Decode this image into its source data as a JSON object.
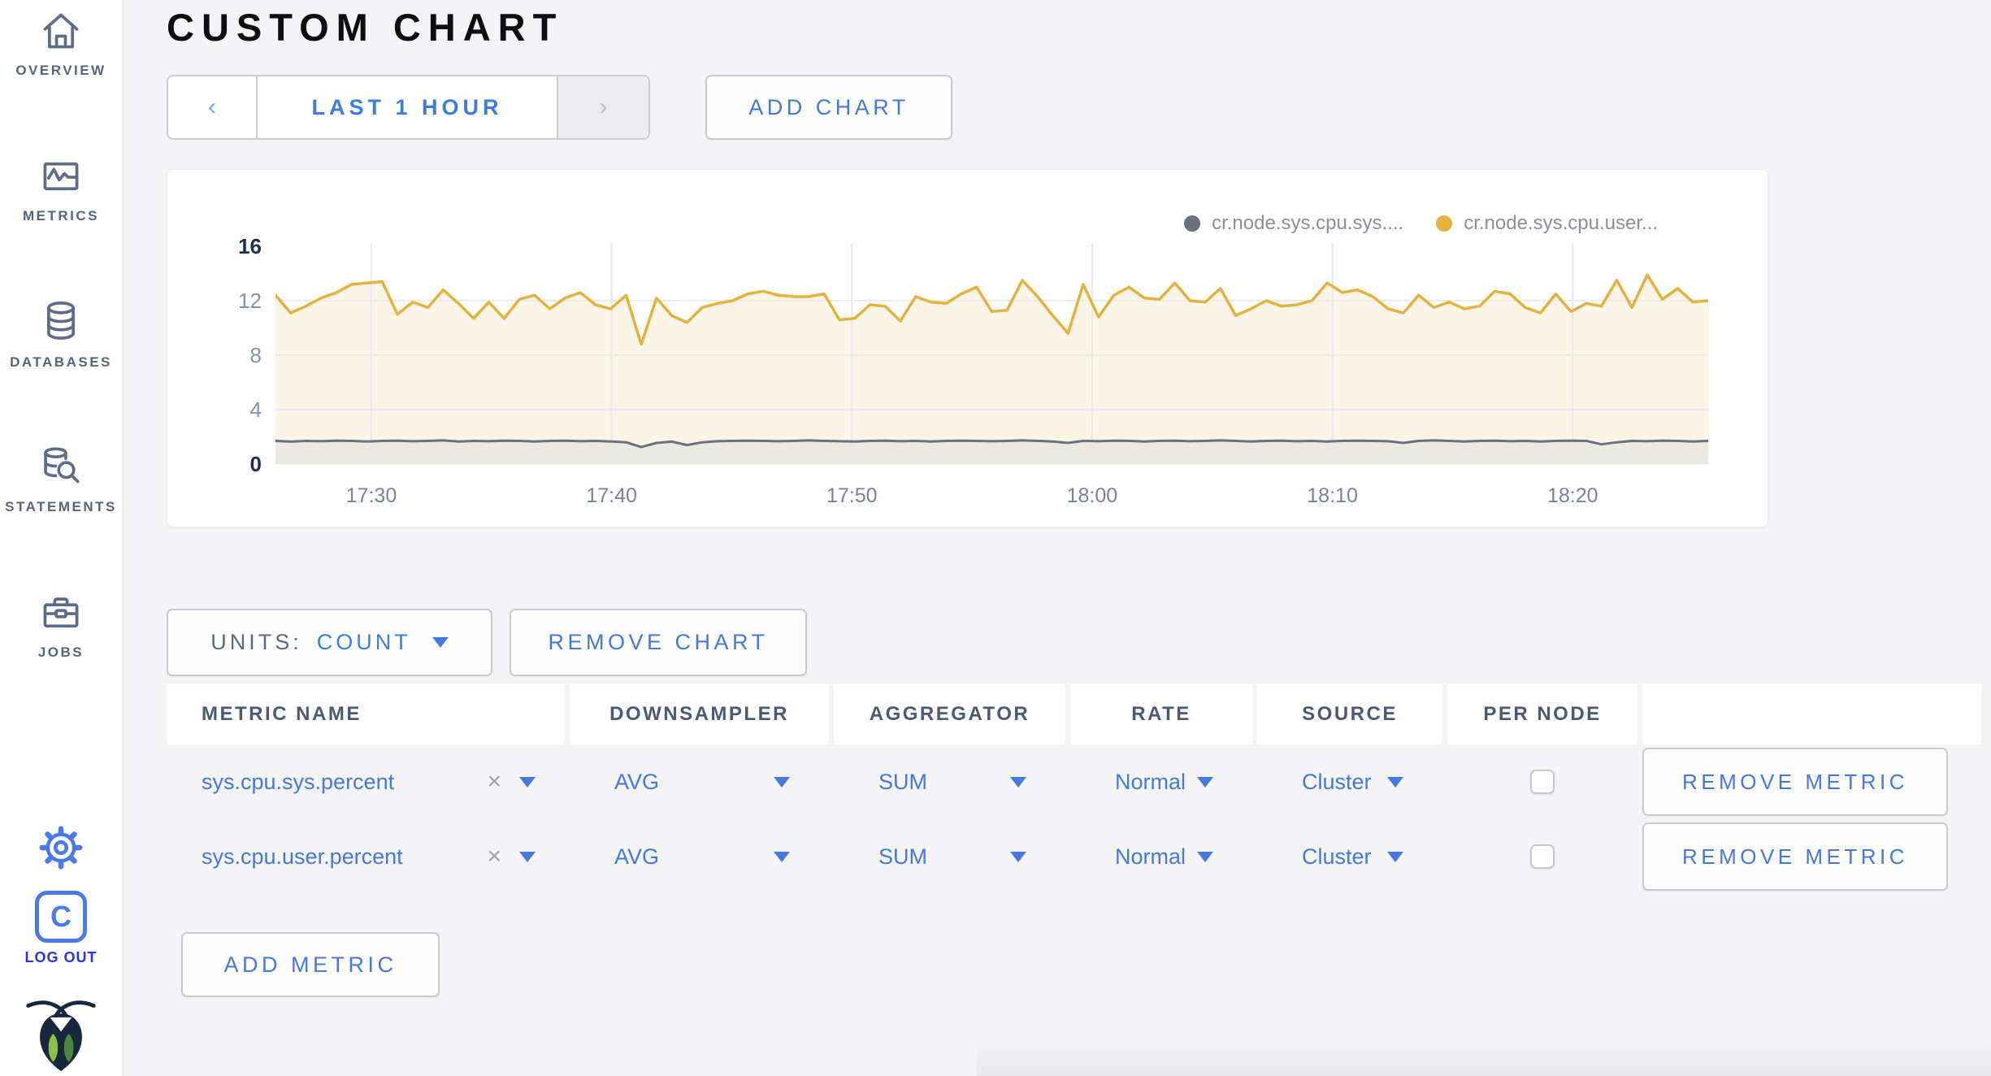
{
  "colors": {
    "accent_blue": "#4678DE",
    "logout_blue": "#2936E0",
    "sidebar_icon_slate": "#5F6C87",
    "settings_icon_blue": "#4C79E8"
  },
  "sidebar": {
    "items": [
      {
        "label": "OVERVIEW",
        "icon": "home-icon"
      },
      {
        "label": "METRICS",
        "icon": "line-chart-icon"
      },
      {
        "label": "DATABASES",
        "icon": "database-icon"
      },
      {
        "label": "STATEMENTS",
        "icon": "database-search-icon"
      },
      {
        "label": "JOBS",
        "icon": "briefcase-icon"
      }
    ],
    "logout": {
      "letter": "C",
      "label": "LOG OUT"
    }
  },
  "header": {
    "title": "CUSTOM CHART"
  },
  "time_selector": {
    "prev_glyph": "‹",
    "label": "LAST 1 HOUR",
    "next_glyph": "›"
  },
  "add_chart_label": "ADD CHART",
  "chart_data": {
    "type": "area",
    "title": "",
    "legend_position": "top-right",
    "grid": true,
    "ylim": [
      0,
      16
    ],
    "y_ticks": [
      16,
      12,
      8,
      4,
      0
    ],
    "x_tick_labels": [
      "17:30",
      "17:40",
      "17:50",
      "18:00",
      "18:10",
      "18:20"
    ],
    "x_tick_fractions": [
      0.0669,
      0.2346,
      0.4023,
      0.57,
      0.7377,
      0.9054
    ],
    "series": [
      {
        "name": "cr.node.sys.cpu.sys....",
        "color": "#69707E",
        "fill": "#EBE9E2",
        "line_width": 3,
        "values": [
          1.7,
          1.65,
          1.7,
          1.68,
          1.72,
          1.7,
          1.66,
          1.7,
          1.72,
          1.68,
          1.7,
          1.74,
          1.66,
          1.7,
          1.68,
          1.72,
          1.7,
          1.66,
          1.7,
          1.72,
          1.68,
          1.7,
          1.66,
          1.6,
          1.25,
          1.55,
          1.65,
          1.4,
          1.6,
          1.68,
          1.7,
          1.72,
          1.7,
          1.68,
          1.7,
          1.74,
          1.7,
          1.68,
          1.66,
          1.7,
          1.72,
          1.68,
          1.7,
          1.66,
          1.7,
          1.72,
          1.7,
          1.68,
          1.7,
          1.74,
          1.7,
          1.66,
          1.55,
          1.7,
          1.68,
          1.72,
          1.7,
          1.66,
          1.7,
          1.72,
          1.68,
          1.7,
          1.74,
          1.7,
          1.66,
          1.7,
          1.72,
          1.68,
          1.7,
          1.66,
          1.7,
          1.72,
          1.7,
          1.68,
          1.55,
          1.7,
          1.74,
          1.7,
          1.66,
          1.7,
          1.72,
          1.68,
          1.7,
          1.66,
          1.7,
          1.72,
          1.7,
          1.45,
          1.6,
          1.7,
          1.68,
          1.72,
          1.7,
          1.66,
          1.7
        ]
      },
      {
        "name": "cr.node.sys.cpu.user...",
        "color": "#E3B23F",
        "fill": "#FAF5E7",
        "line_width": 3.5,
        "values": [
          12.4,
          11.1,
          11.6,
          12.2,
          12.6,
          13.2,
          13.3,
          13.4,
          11.0,
          11.9,
          11.5,
          12.8,
          11.8,
          10.7,
          11.9,
          10.7,
          12.1,
          12.4,
          11.4,
          12.2,
          12.6,
          11.7,
          11.4,
          12.4,
          8.8,
          12.2,
          10.9,
          10.4,
          11.5,
          11.8,
          12.0,
          12.5,
          12.7,
          12.4,
          12.3,
          12.3,
          12.5,
          10.6,
          10.7,
          11.7,
          11.6,
          10.5,
          12.3,
          11.9,
          11.8,
          12.5,
          13.0,
          11.2,
          11.3,
          13.5,
          12.3,
          10.9,
          9.6,
          13.2,
          10.8,
          12.4,
          13.0,
          12.2,
          12.1,
          13.3,
          12.0,
          11.9,
          12.9,
          10.9,
          11.4,
          12.0,
          11.6,
          11.7,
          12.0,
          13.3,
          12.6,
          12.8,
          12.3,
          11.4,
          11.1,
          12.4,
          11.5,
          11.9,
          11.4,
          11.6,
          12.7,
          12.5,
          11.5,
          11.1,
          12.5,
          11.2,
          11.8,
          11.6,
          13.5,
          11.5,
          13.9,
          12.1,
          12.9,
          11.9,
          12.0
        ]
      }
    ],
    "grid_vertical_color": "#E7E7EA",
    "grid_horizontal_color": "#ECECEE"
  },
  "units": {
    "label": "UNITS:",
    "value": "COUNT"
  },
  "remove_chart_label": "REMOVE CHART",
  "metrics_table": {
    "headers": [
      "METRIC NAME",
      "DOWNSAMPLER",
      "AGGREGATOR",
      "RATE",
      "SOURCE",
      "PER NODE"
    ],
    "close_glyph": "×",
    "rows": [
      {
        "metric": "sys.cpu.sys.percent",
        "downsampler": "AVG",
        "aggregator": "SUM",
        "rate": "Normal",
        "source": "Cluster",
        "per_node": false,
        "remove_label": "REMOVE METRIC"
      },
      {
        "metric": "sys.cpu.user.percent",
        "downsampler": "AVG",
        "aggregator": "SUM",
        "rate": "Normal",
        "source": "Cluster",
        "per_node": false,
        "remove_label": "REMOVE METRIC"
      }
    ]
  },
  "add_metric_label": "ADD METRIC"
}
